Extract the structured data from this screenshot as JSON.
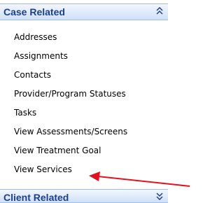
{
  "case_related": {
    "title": "Case Related",
    "links": [
      "Addresses",
      "Assignments",
      "Contacts",
      "Provider/Program Statuses",
      "Tasks",
      "View Assessments/Screens",
      "View Treatment Goal",
      "View Services"
    ]
  },
  "client_related": {
    "title": "Client Related"
  },
  "colors": {
    "header_text": "#1c3f94",
    "header_border": "#9fbde6",
    "annotation_arrow": "#e5101e"
  },
  "icons": {
    "collapse": "double-chevron-up-icon",
    "expand": "double-chevron-down-icon"
  }
}
